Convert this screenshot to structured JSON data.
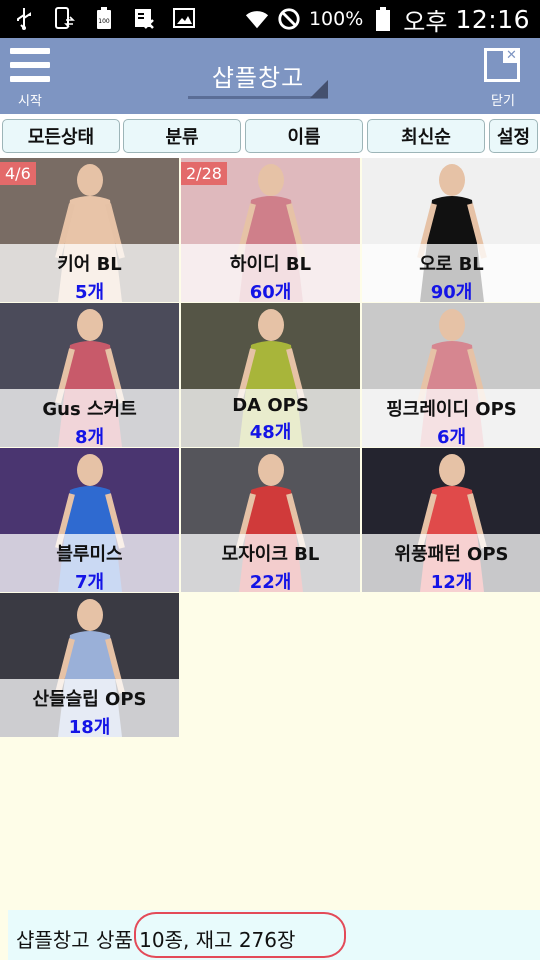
{
  "status_bar": {
    "battery_percent": "100%",
    "ampm": "오후",
    "time": "12:16",
    "icons": [
      "usb-icon",
      "phone-sync-icon",
      "battery-100-icon",
      "disabled-app-icon",
      "image-icon",
      "wifi-icon",
      "do-not-disturb-icon",
      "battery-icon"
    ]
  },
  "header": {
    "menu_label": "시작",
    "title": "샵플창고",
    "close_label": "닫기"
  },
  "filters": [
    "모든상태",
    "분류",
    "이름",
    "최신순",
    "설정"
  ],
  "products": [
    {
      "name": "키어 BL",
      "count": "5개",
      "badge": "4/6",
      "colors": [
        "#3a2a22",
        "#e8c4a8",
        "#f2e8e0"
      ]
    },
    {
      "name": "하이디 BL",
      "count": "60개",
      "badge": "2/28",
      "colors": [
        "#d9a8ae",
        "#cf7f8a",
        "#eadada"
      ]
    },
    {
      "name": "오로 BL",
      "count": "90개",
      "badge": "",
      "colors": [
        "#f4f4f4",
        "#111111",
        "#e9e9e9"
      ]
    },
    {
      "name": "Gus 스커트",
      "count": "8개",
      "badge": "",
      "colors": [
        "#3a3a48",
        "#c85a6a",
        "#6d6d7d"
      ]
    },
    {
      "name": "DA OPS",
      "count": "48개",
      "badge": "",
      "colors": [
        "#3a3a30",
        "#a8b53a",
        "#8a8a70"
      ]
    },
    {
      "name": "핑크레이디 OPS",
      "count": "6개",
      "badge": "",
      "colors": [
        "#cfcfcf",
        "#d68690",
        "#bcbcbc"
      ]
    },
    {
      "name": "블루미스",
      "count": "7개",
      "badge": "",
      "colors": [
        "#3a2a5a",
        "#2f6ad0",
        "#6b4a9a"
      ]
    },
    {
      "name": "모자이크 BL",
      "count": "22개",
      "badge": "",
      "colors": [
        "#3a3a40",
        "#d03a3a",
        "#8a8a90"
      ]
    },
    {
      "name": "위풍패턴 OPS",
      "count": "12개",
      "badge": "",
      "colors": [
        "#1a1a22",
        "#e04a4a",
        "#3a3a48"
      ]
    },
    {
      "name": "산들슬립 OPS",
      "count": "18개",
      "badge": "",
      "colors": [
        "#2a2a30",
        "#9ab0d8",
        "#5a5a66"
      ]
    }
  ],
  "footer": {
    "summary": "샵플창고 상품 10종, 재고 276장"
  }
}
